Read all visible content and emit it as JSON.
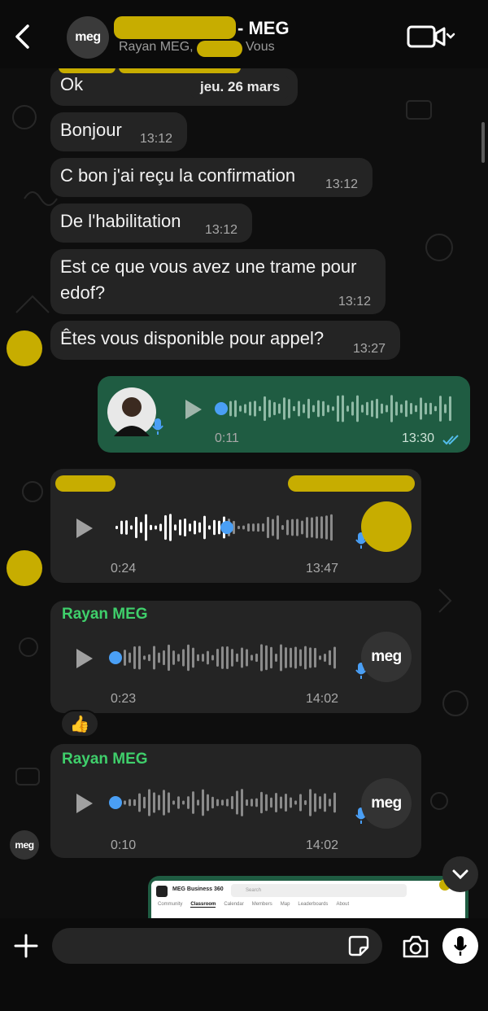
{
  "header": {
    "title_suffix": "- MEG",
    "subtitle_name": "Rayan MEG,",
    "subtitle_you": "Vous",
    "avatar_logo": "meg"
  },
  "date_chip": "jeu. 26 mars",
  "messages": [
    {
      "text": "Ok",
      "time": ""
    },
    {
      "text": "Bonjour",
      "time": "13:12"
    },
    {
      "text": "C bon j'ai reçu la confirmation",
      "time": "13:12"
    },
    {
      "text": "De l'habilitation",
      "time": "13:12"
    },
    {
      "text": "Est ce que vous avez une trame pour edof?",
      "time": "13:12"
    },
    {
      "text": "Êtes vous disponible pour appel?",
      "time": "13:27"
    }
  ],
  "voice_out": {
    "duration": "0:11",
    "time": "13:30",
    "status": "read"
  },
  "voice_in_1": {
    "duration": "0:24",
    "time": "13:47"
  },
  "voice_in_2": {
    "sender": "Rayan MEG",
    "duration": "0:23",
    "time": "14:02",
    "avatar_logo": "meg",
    "reaction": "👍"
  },
  "voice_in_3": {
    "sender": "Rayan MEG",
    "duration": "0:10",
    "time": "14:02",
    "avatar_logo": "meg"
  },
  "side_avatar_logo": "meg",
  "preview": {
    "title": "MEG Business 360",
    "search_placeholder": "Search",
    "tabs": [
      "Community",
      "Classroom",
      "Calendar",
      "Members",
      "Map",
      "Leaderboards",
      "About"
    ],
    "active_tab": "Classroom"
  },
  "icons": {
    "back": "chevron-left-icon",
    "video": "video-camera-icon",
    "plus": "plus-icon",
    "sticker": "sticker-icon",
    "camera": "camera-icon",
    "mic": "microphone-icon",
    "play": "play-icon",
    "scroll_down": "chevron-down-icon"
  },
  "colors": {
    "accent_green": "#3fcf6b",
    "outgoing_bubble": "#1f5c42",
    "incoming_bubble": "#242424",
    "redaction": "#c7ad00",
    "read_ticks": "#53bdeb",
    "waveform_dot": "#4a9ff5"
  }
}
